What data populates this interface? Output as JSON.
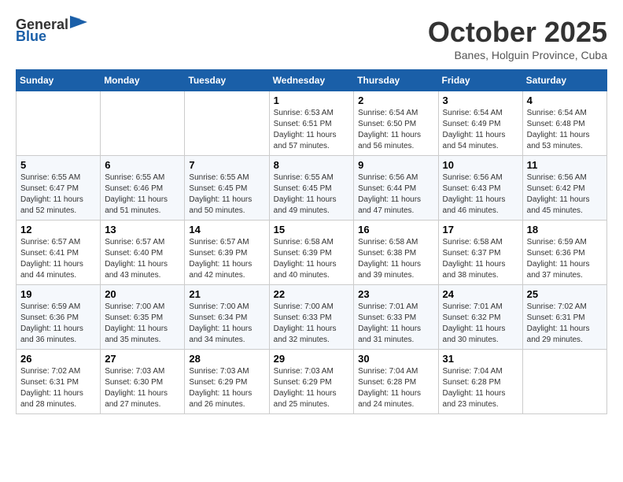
{
  "header": {
    "logo_general": "General",
    "logo_blue": "Blue",
    "month_title": "October 2025",
    "subtitle": "Banes, Holguin Province, Cuba"
  },
  "weekdays": [
    "Sunday",
    "Monday",
    "Tuesday",
    "Wednesday",
    "Thursday",
    "Friday",
    "Saturday"
  ],
  "weeks": [
    [
      {
        "day": "",
        "info": ""
      },
      {
        "day": "",
        "info": ""
      },
      {
        "day": "",
        "info": ""
      },
      {
        "day": "1",
        "info": "Sunrise: 6:53 AM\nSunset: 6:51 PM\nDaylight: 11 hours and 57 minutes."
      },
      {
        "day": "2",
        "info": "Sunrise: 6:54 AM\nSunset: 6:50 PM\nDaylight: 11 hours and 56 minutes."
      },
      {
        "day": "3",
        "info": "Sunrise: 6:54 AM\nSunset: 6:49 PM\nDaylight: 11 hours and 54 minutes."
      },
      {
        "day": "4",
        "info": "Sunrise: 6:54 AM\nSunset: 6:48 PM\nDaylight: 11 hours and 53 minutes."
      }
    ],
    [
      {
        "day": "5",
        "info": "Sunrise: 6:55 AM\nSunset: 6:47 PM\nDaylight: 11 hours and 52 minutes."
      },
      {
        "day": "6",
        "info": "Sunrise: 6:55 AM\nSunset: 6:46 PM\nDaylight: 11 hours and 51 minutes."
      },
      {
        "day": "7",
        "info": "Sunrise: 6:55 AM\nSunset: 6:45 PM\nDaylight: 11 hours and 50 minutes."
      },
      {
        "day": "8",
        "info": "Sunrise: 6:55 AM\nSunset: 6:45 PM\nDaylight: 11 hours and 49 minutes."
      },
      {
        "day": "9",
        "info": "Sunrise: 6:56 AM\nSunset: 6:44 PM\nDaylight: 11 hours and 47 minutes."
      },
      {
        "day": "10",
        "info": "Sunrise: 6:56 AM\nSunset: 6:43 PM\nDaylight: 11 hours and 46 minutes."
      },
      {
        "day": "11",
        "info": "Sunrise: 6:56 AM\nSunset: 6:42 PM\nDaylight: 11 hours and 45 minutes."
      }
    ],
    [
      {
        "day": "12",
        "info": "Sunrise: 6:57 AM\nSunset: 6:41 PM\nDaylight: 11 hours and 44 minutes."
      },
      {
        "day": "13",
        "info": "Sunrise: 6:57 AM\nSunset: 6:40 PM\nDaylight: 11 hours and 43 minutes."
      },
      {
        "day": "14",
        "info": "Sunrise: 6:57 AM\nSunset: 6:39 PM\nDaylight: 11 hours and 42 minutes."
      },
      {
        "day": "15",
        "info": "Sunrise: 6:58 AM\nSunset: 6:39 PM\nDaylight: 11 hours and 40 minutes."
      },
      {
        "day": "16",
        "info": "Sunrise: 6:58 AM\nSunset: 6:38 PM\nDaylight: 11 hours and 39 minutes."
      },
      {
        "day": "17",
        "info": "Sunrise: 6:58 AM\nSunset: 6:37 PM\nDaylight: 11 hours and 38 minutes."
      },
      {
        "day": "18",
        "info": "Sunrise: 6:59 AM\nSunset: 6:36 PM\nDaylight: 11 hours and 37 minutes."
      }
    ],
    [
      {
        "day": "19",
        "info": "Sunrise: 6:59 AM\nSunset: 6:36 PM\nDaylight: 11 hours and 36 minutes."
      },
      {
        "day": "20",
        "info": "Sunrise: 7:00 AM\nSunset: 6:35 PM\nDaylight: 11 hours and 35 minutes."
      },
      {
        "day": "21",
        "info": "Sunrise: 7:00 AM\nSunset: 6:34 PM\nDaylight: 11 hours and 34 minutes."
      },
      {
        "day": "22",
        "info": "Sunrise: 7:00 AM\nSunset: 6:33 PM\nDaylight: 11 hours and 32 minutes."
      },
      {
        "day": "23",
        "info": "Sunrise: 7:01 AM\nSunset: 6:33 PM\nDaylight: 11 hours and 31 minutes."
      },
      {
        "day": "24",
        "info": "Sunrise: 7:01 AM\nSunset: 6:32 PM\nDaylight: 11 hours and 30 minutes."
      },
      {
        "day": "25",
        "info": "Sunrise: 7:02 AM\nSunset: 6:31 PM\nDaylight: 11 hours and 29 minutes."
      }
    ],
    [
      {
        "day": "26",
        "info": "Sunrise: 7:02 AM\nSunset: 6:31 PM\nDaylight: 11 hours and 28 minutes."
      },
      {
        "day": "27",
        "info": "Sunrise: 7:03 AM\nSunset: 6:30 PM\nDaylight: 11 hours and 27 minutes."
      },
      {
        "day": "28",
        "info": "Sunrise: 7:03 AM\nSunset: 6:29 PM\nDaylight: 11 hours and 26 minutes."
      },
      {
        "day": "29",
        "info": "Sunrise: 7:03 AM\nSunset: 6:29 PM\nDaylight: 11 hours and 25 minutes."
      },
      {
        "day": "30",
        "info": "Sunrise: 7:04 AM\nSunset: 6:28 PM\nDaylight: 11 hours and 24 minutes."
      },
      {
        "day": "31",
        "info": "Sunrise: 7:04 AM\nSunset: 6:28 PM\nDaylight: 11 hours and 23 minutes."
      },
      {
        "day": "",
        "info": ""
      }
    ]
  ]
}
